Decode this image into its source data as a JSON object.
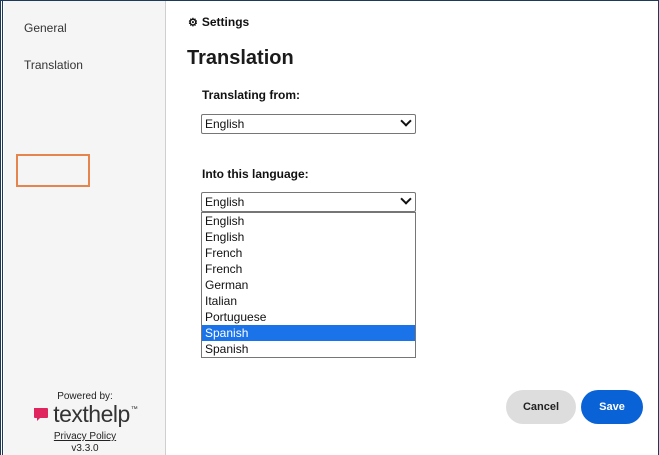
{
  "sidebar": {
    "items": [
      {
        "label": "General"
      },
      {
        "label": "Translation"
      }
    ],
    "powered_by": "Powered by:",
    "brand": {
      "name": "texthelp",
      "tm": "™",
      "color": "#e0245e"
    },
    "privacy_policy": "Privacy Policy",
    "version": "v3.3.0"
  },
  "header": {
    "title": "Settings",
    "icon": "gear-icon"
  },
  "main": {
    "title": "Translation",
    "from": {
      "label": "Translating from:",
      "value": "English"
    },
    "into": {
      "label": "Into this language:",
      "value": "English"
    },
    "dropdown": {
      "options": [
        "English",
        "English",
        "French",
        "French",
        "German",
        "Italian",
        "Portuguese",
        "Spanish",
        "Spanish"
      ],
      "selected_index": 7
    }
  },
  "footer": {
    "cancel": "Cancel",
    "save": "Save"
  },
  "colors": {
    "accent": "#0a63d6",
    "focus_outline": "#e5854d",
    "highlight": "#1a73e8"
  }
}
